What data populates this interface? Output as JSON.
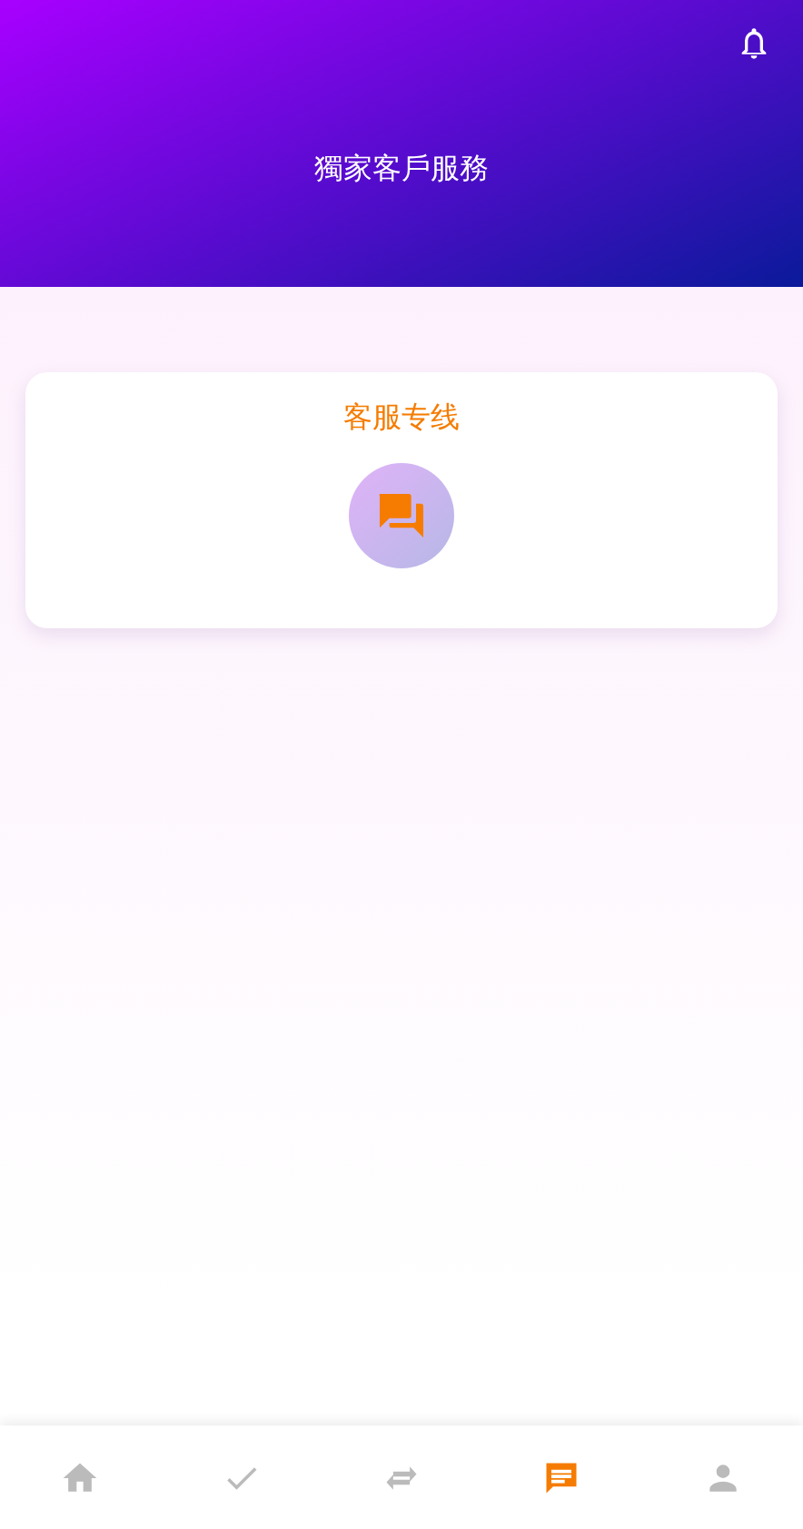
{
  "header": {
    "title": "獨家客戶服務"
  },
  "card": {
    "title": "客服专线"
  },
  "bottom_nav": [
    {
      "kind": "home",
      "selected": false
    },
    {
      "kind": "check",
      "selected": false
    },
    {
      "kind": "exchange",
      "selected": false
    },
    {
      "kind": "chat",
      "selected": true
    },
    {
      "kind": "person",
      "selected": false
    }
  ]
}
